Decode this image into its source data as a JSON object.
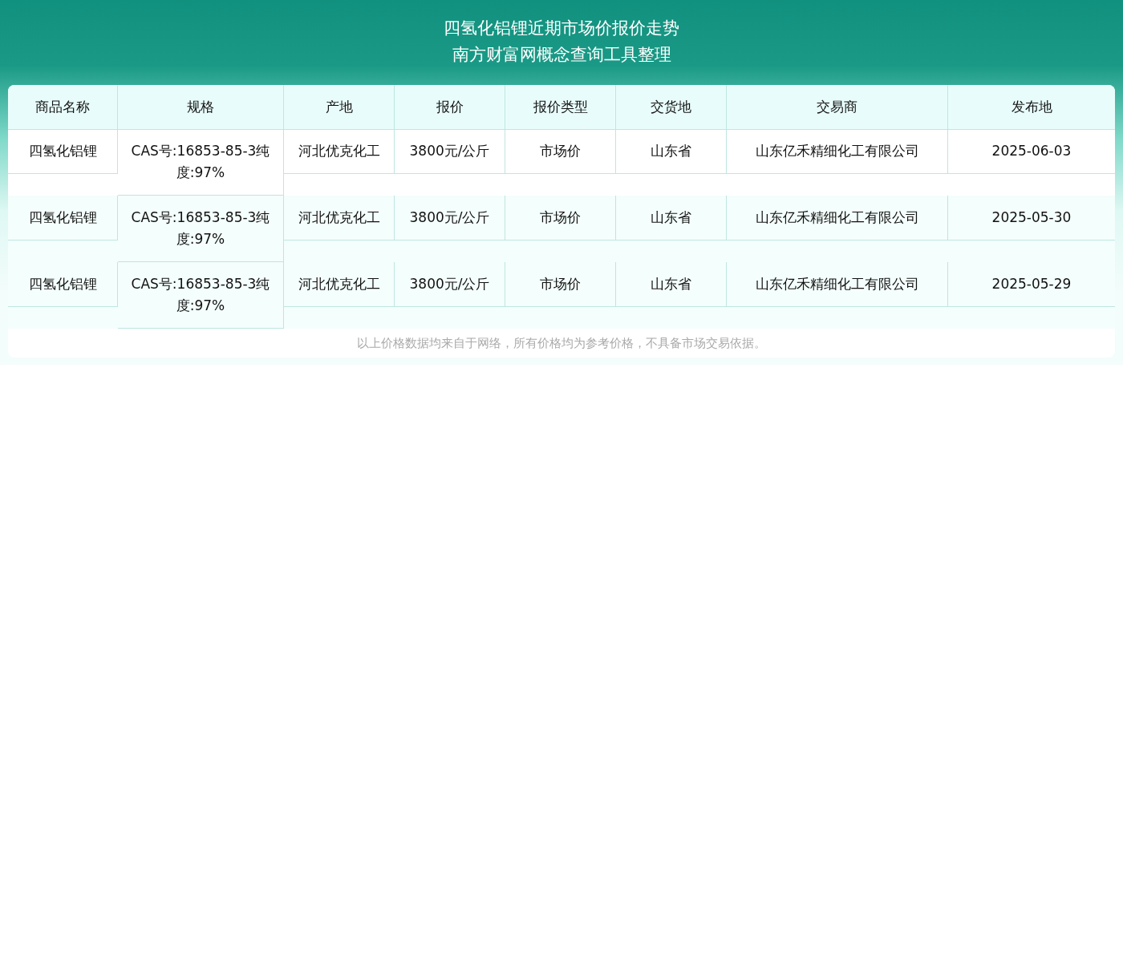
{
  "title": [
    "四氢化铝锂近期市场价报价走势",
    "南方财富网概念查询工具整理"
  ],
  "table": {
    "columns": [
      "商品名称",
      "规格",
      "产地",
      "报价",
      "报价类型",
      "交货地",
      "交易商",
      "发布地"
    ],
    "rows": [
      {
        "cells": [
          "四氢化铝锂",
          "CAS号:16853-85-3纯度:97%",
          "河北优克化工",
          "3800元/公斤",
          "市场价",
          "山东省",
          "山东亿禾精细化工有限公司",
          "2025-06-03"
        ]
      },
      {
        "cells": [
          "四氢化铝锂",
          "CAS号:16853-85-3纯度:97%",
          "河北优克化工",
          "3800元/公斤",
          "市场价",
          "山东省",
          "山东亿禾精细化工有限公司",
          "2025-05-30"
        ]
      },
      {
        "cells": [
          "四氢化铝锂",
          "CAS号:16853-85-3纯度:97%",
          "河北优克化工",
          "3800元/公斤",
          "市场价",
          "山东省",
          "山东亿禾精细化工有限公司",
          "2025-05-29"
        ]
      }
    ]
  },
  "footnote": "以上价格数据均来自于网络，所有价格均为参考价格，不具备市场交易依据。"
}
